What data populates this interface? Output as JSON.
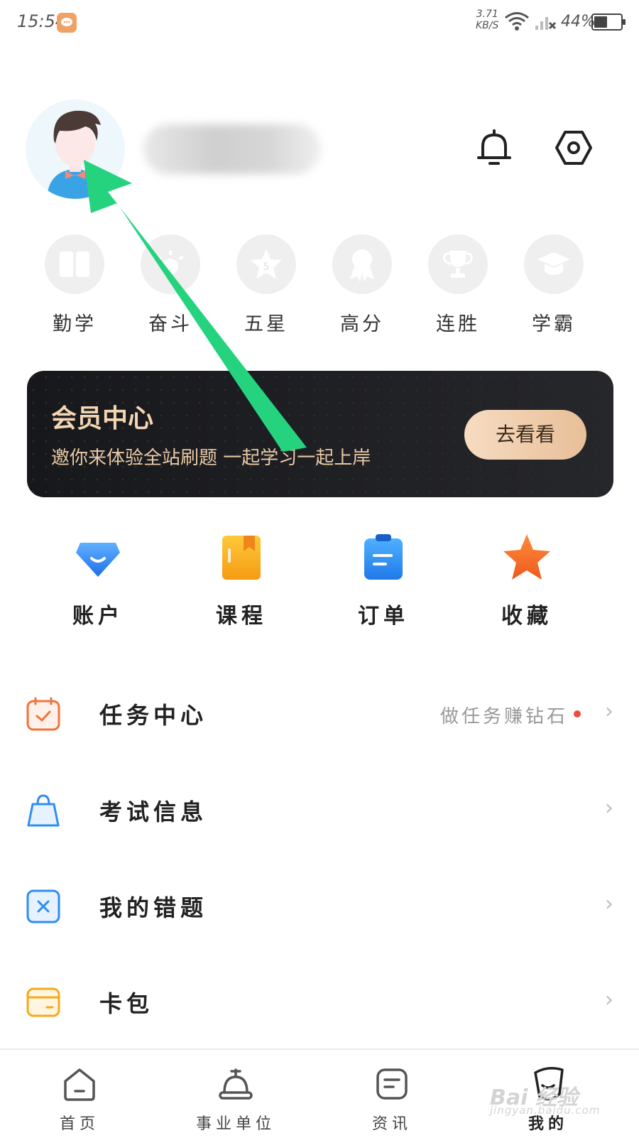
{
  "status_bar": {
    "time": "15:54",
    "net_speed_value": "3.71",
    "net_speed_unit": "KB/S",
    "battery_percent": "44%",
    "battery_level": 0.44
  },
  "profile": {
    "avatar_icon": "boy-avatar",
    "notification_icon": "bell-icon",
    "settings_icon": "hexagon-gear-icon"
  },
  "badges": [
    {
      "label": "勤学",
      "icon": "book-icon"
    },
    {
      "label": "奋斗",
      "icon": "sun-icon"
    },
    {
      "label": "五星",
      "icon": "star-5-icon"
    },
    {
      "label": "高分",
      "icon": "ribbon-medal-icon"
    },
    {
      "label": "连胜",
      "icon": "trophy-icon"
    },
    {
      "label": "学霸",
      "icon": "graduation-cap-icon"
    }
  ],
  "member_banner": {
    "title": "会员中心",
    "subtitle": "邀你来体验全站刷题  一起学习一起上岸",
    "button": "去看看"
  },
  "quick_actions": [
    {
      "label": "账户",
      "icon": "wallet-icon",
      "color": "#2f8cf5"
    },
    {
      "label": "课程",
      "icon": "course-book-icon",
      "color": "#f6a91a"
    },
    {
      "label": "订单",
      "icon": "order-clipboard-icon",
      "color": "#2e8df4"
    },
    {
      "label": "收藏",
      "icon": "star-icon",
      "color": "#f26a2a"
    }
  ],
  "menu": [
    {
      "label": "任务中心",
      "hint": "做任务赚钻石",
      "icon": "calendar-check-icon",
      "color": "#f0743a",
      "has_dot": true
    },
    {
      "label": "考试信息",
      "hint": "",
      "icon": "bag-icon",
      "color": "#2e8df4",
      "has_dot": false
    },
    {
      "label": "我的错题",
      "hint": "",
      "icon": "x-box-icon",
      "color": "#2e8df4",
      "has_dot": false
    },
    {
      "label": "卡包",
      "hint": "",
      "icon": "card-icon",
      "color": "#f6a91a",
      "has_dot": false
    }
  ],
  "tabs": [
    {
      "label": "首页",
      "icon": "home-icon"
    },
    {
      "label": "事业单位",
      "icon": "bell-dome-icon"
    },
    {
      "label": "资讯",
      "icon": "news-icon"
    },
    {
      "label": "我的",
      "icon": "me-face-icon"
    }
  ],
  "chevron": "›",
  "watermark": {
    "text": "Bai 经验",
    "sub": "jingyan.baidu.com"
  }
}
